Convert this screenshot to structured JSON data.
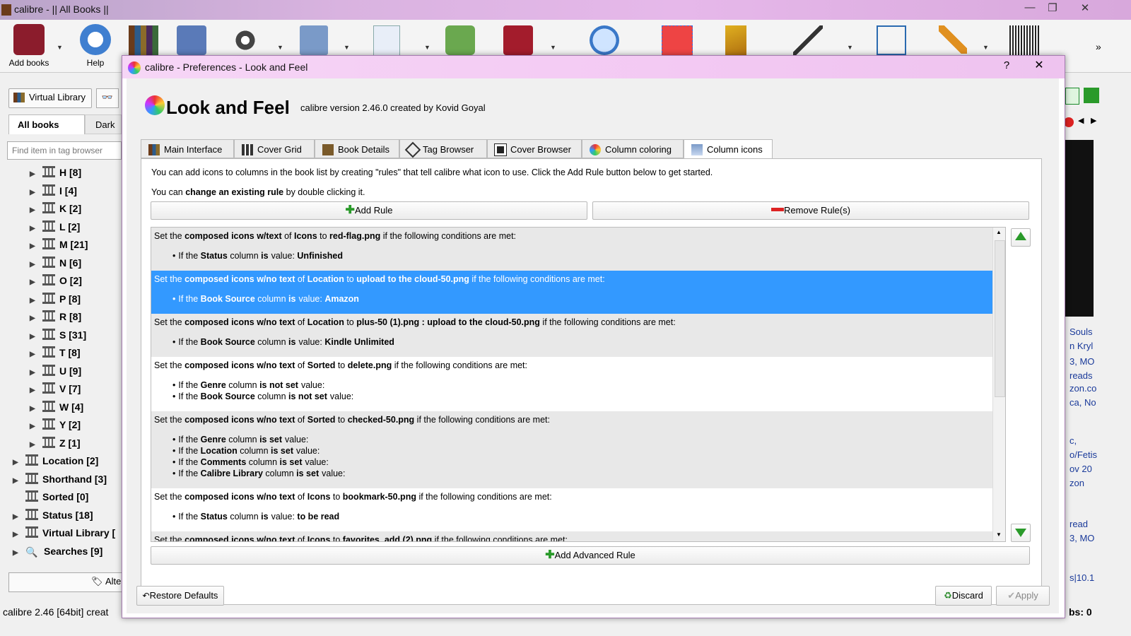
{
  "window": {
    "title": "calibre - || All Books ||",
    "minimize": "—",
    "maximize": "❐",
    "close": "✕"
  },
  "toolbar": {
    "add_books": "Add books",
    "help": "Help",
    "overflow": "»"
  },
  "left": {
    "virtual_library": "Virtual Library",
    "tabs": [
      "All books",
      "Dark"
    ],
    "search_placeholder": "Find item in tag browser",
    "tree": [
      {
        "label": "H [8]",
        "level": 1
      },
      {
        "label": "I [4]",
        "level": 1
      },
      {
        "label": "K [2]",
        "level": 1
      },
      {
        "label": "L [2]",
        "level": 1
      },
      {
        "label": "M [21]",
        "level": 1
      },
      {
        "label": "N [6]",
        "level": 1
      },
      {
        "label": "O [2]",
        "level": 1
      },
      {
        "label": "P [8]",
        "level": 1
      },
      {
        "label": "R [8]",
        "level": 1
      },
      {
        "label": "S [31]",
        "level": 1
      },
      {
        "label": "T [8]",
        "level": 1
      },
      {
        "label": "U [9]",
        "level": 1
      },
      {
        "label": "V [7]",
        "level": 1
      },
      {
        "label": "W [4]",
        "level": 1
      },
      {
        "label": "Y [2]",
        "level": 1
      },
      {
        "label": "Z [1]",
        "level": 1
      },
      {
        "label": "Location [2]",
        "level": 0
      },
      {
        "label": "Shorthand [3]",
        "level": 0
      },
      {
        "label": "Sorted [0]",
        "level": 0,
        "noarrow": true
      },
      {
        "label": "Status [18]",
        "level": 0
      },
      {
        "label": "Virtual Library [",
        "level": 0
      },
      {
        "label": "Searches [9]",
        "level": 0,
        "icon": "binoculars"
      }
    ],
    "alter_button": "Alter"
  },
  "statusbar": {
    "text": "calibre 2.46 [64bit] creat",
    "right": "bs: 0"
  },
  "right_strip": {
    "lines": [
      "Souls",
      "n Kryl",
      "3, MO",
      "reads",
      "zon.co",
      "ca, No",
      "c,",
      "o/Fetis",
      "ov 20",
      "zon",
      "read",
      "3, MO",
      "s|10.1"
    ]
  },
  "dialog": {
    "title": "calibre - Preferences - Look and Feel",
    "help": "?",
    "close": "✕",
    "header": "Look and Feel",
    "version": "calibre version 2.46.0 created by Kovid Goyal",
    "tabs": [
      "Main Interface",
      "Cover Grid",
      "Book Details",
      "Tag Browser",
      "Cover Browser",
      "Column coloring",
      "Column icons"
    ],
    "active_tab": "Column icons",
    "intro1": "You can add icons to columns in the book list by creating \"rules\" that tell calibre what icon to use. Click the Add Rule button below to get started.",
    "intro2_pre": "You can ",
    "intro2_bold": "change an existing rule",
    "intro2_post": " by double clicking it.",
    "add_rule": "Add Rule",
    "remove_rule": "Remove Rule(s)",
    "add_advanced_rule": "Add Advanced Rule",
    "restore_defaults": "Restore Defaults",
    "discard": "Discard",
    "apply": "Apply",
    "rules": [
      {
        "kind": "composed icons w/text",
        "column": "Icons",
        "icon": "red-flag.png",
        "conds": [
          [
            "Status",
            "is",
            "value: ",
            "Unfinished"
          ]
        ],
        "style": "alt"
      },
      {
        "kind": "composed icons w/no text",
        "column": "Location",
        "icon": "upload to the cloud-50.png",
        "conds": [
          [
            "Book Source",
            "is",
            "value: ",
            "Amazon"
          ]
        ],
        "style": "sel"
      },
      {
        "kind": "composed icons w/no text",
        "column": "Location",
        "icon": "plus-50 (1).png : upload to the cloud-50.png",
        "conds": [
          [
            "Book Source",
            "is",
            "value: ",
            "Kindle Unlimited"
          ]
        ],
        "style": "alt"
      },
      {
        "kind": "composed icons w/no text",
        "column": "Sorted",
        "icon": "delete.png",
        "conds": [
          [
            "Genre",
            "is not set",
            "value:",
            ""
          ],
          [
            "Book Source",
            "is not set",
            "value:",
            ""
          ]
        ],
        "style": "white"
      },
      {
        "kind": "composed icons w/no text",
        "column": "Sorted",
        "icon": "checked-50.png",
        "conds": [
          [
            "Genre",
            "is set",
            "value:",
            ""
          ],
          [
            "Location",
            "is set",
            "value:",
            ""
          ],
          [
            "Comments",
            "is set",
            "value:",
            ""
          ],
          [
            "Calibre Library",
            "is set",
            "value:",
            ""
          ]
        ],
        "style": "alt"
      },
      {
        "kind": "composed icons w/no text",
        "column": "Icons",
        "icon": "bookmark-50.png",
        "conds": [
          [
            "Status",
            "is",
            "value: ",
            "to be read"
          ]
        ],
        "style": "white"
      },
      {
        "kind": "composed icons w/no text",
        "column": "Icons",
        "icon": "favorites_add (2).png",
        "conds": [],
        "style": "alt"
      }
    ]
  }
}
